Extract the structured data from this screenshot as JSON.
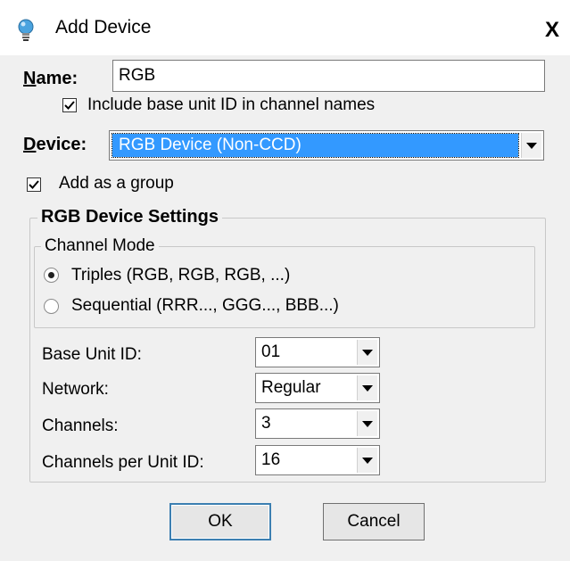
{
  "dialog": {
    "title": "Add Device",
    "close_glyph": "X"
  },
  "name_field": {
    "label": "Name:",
    "value": "RGB"
  },
  "include_base_unit": {
    "label": "Include base unit ID in channel names",
    "checked": true
  },
  "device": {
    "label": "Device:",
    "selected": "RGB Device (Non-CCD)"
  },
  "add_as_group": {
    "label": "Add as a group",
    "checked": true
  },
  "settings": {
    "group_title": "RGB Device Settings",
    "channel_mode": {
      "title": "Channel Mode",
      "options": [
        {
          "label": "Triples (RGB, RGB, RGB, ...)",
          "selected": true
        },
        {
          "label": "Sequential (RRR..., GGG..., BBB...)",
          "selected": false
        }
      ]
    },
    "base_unit_id": {
      "label": "Base Unit ID:",
      "value": "01"
    },
    "network": {
      "label": "Network:",
      "value": "Regular"
    },
    "channels": {
      "label": "Channels:",
      "value": "3"
    },
    "channels_per_unit": {
      "label": "Channels per Unit ID:",
      "value": "16"
    }
  },
  "buttons": {
    "ok": "OK",
    "cancel": "Cancel"
  },
  "icons": {
    "title_icon": "lightbulb-icon",
    "close": "close-icon",
    "dropdown": "chevron-down-icon"
  },
  "colors": {
    "selection_blue": "#3399ff",
    "dialog_bg": "#f0f0f0"
  }
}
